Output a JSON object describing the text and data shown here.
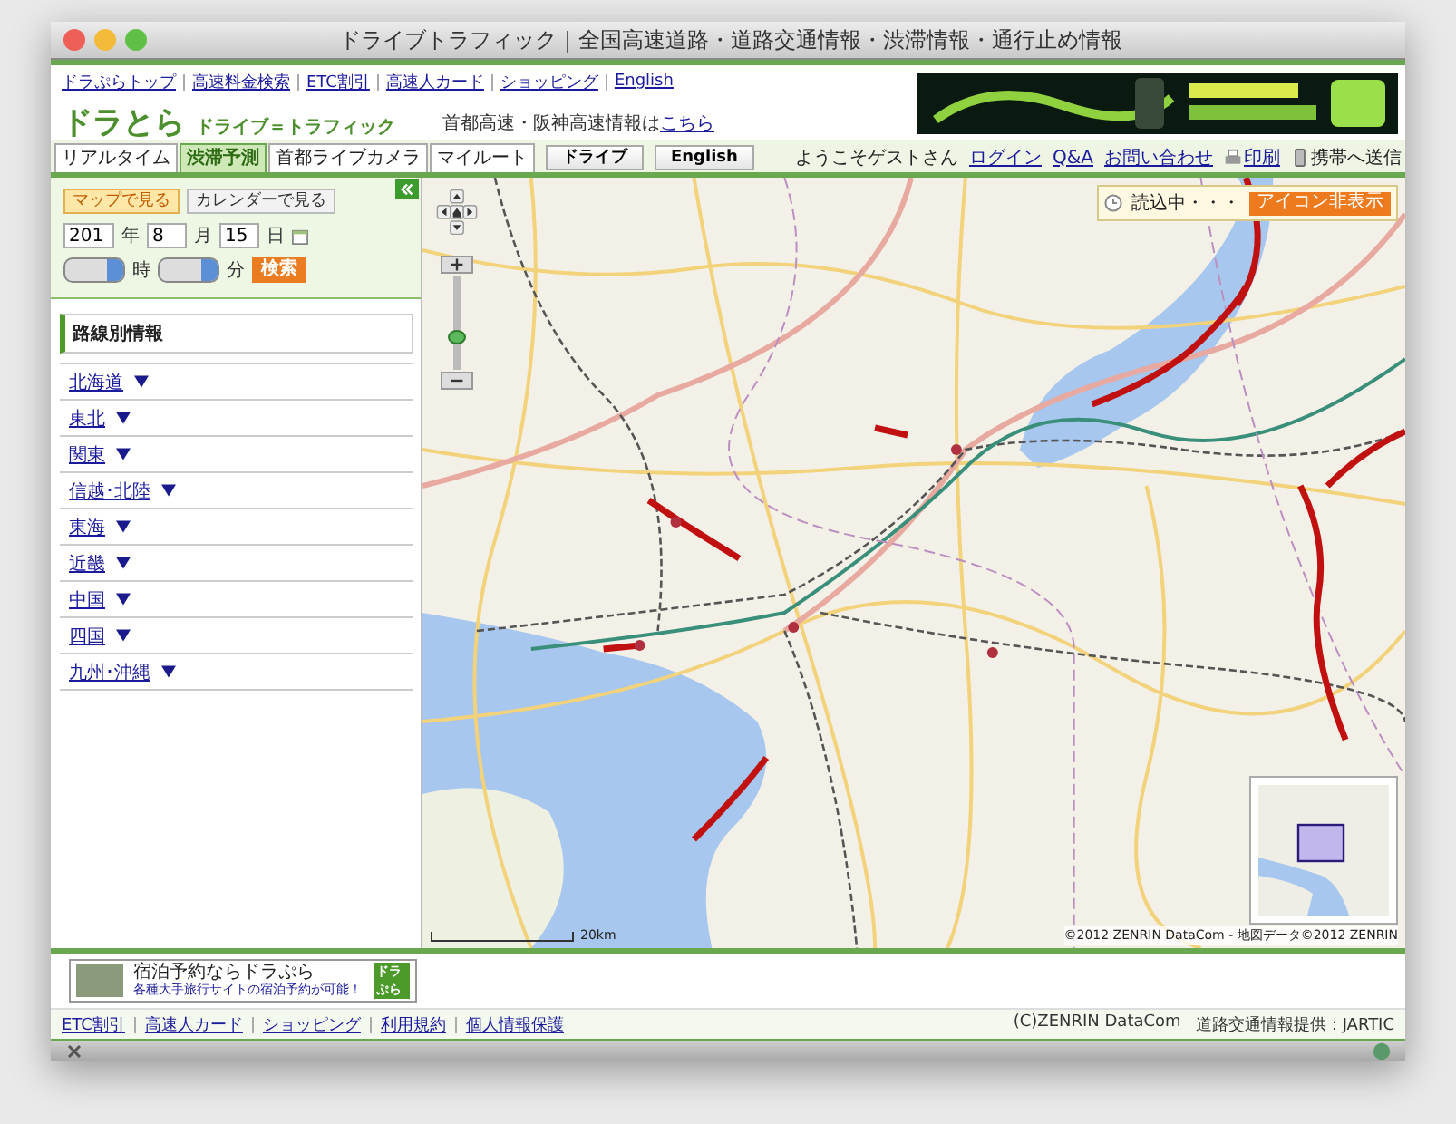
{
  "window": {
    "title": "ドライブトラフィック｜全国高速道路・道路交通情報・渋滞情報・通行止め情報"
  },
  "top_links": [
    "ドラぷらトップ",
    "高速料金検索",
    "ETC割引",
    "高速人カード",
    "ショッピング",
    "English"
  ],
  "logo": {
    "main": "ドラとら",
    "sub": "ドライブ＝トラフィック"
  },
  "notice": {
    "text": "首都高速・阪神高速情報は",
    "link": "こちら"
  },
  "tabs": [
    {
      "label": "リアルタイム",
      "selected": false
    },
    {
      "label": "渋滞予測",
      "selected": true
    },
    {
      "label": "首都ライブカメラ",
      "selected": false
    },
    {
      "label": "マイルート",
      "selected": false
    }
  ],
  "mode_buttons": [
    "ドライブ",
    "English"
  ],
  "user_bar": {
    "greeting": "ようこそゲストさん",
    "links": [
      "ログイン",
      "Q&A",
      "お問い合わせ"
    ],
    "print": "印刷",
    "mobile": "携帯へ送信"
  },
  "panel": {
    "view_buttons": [
      {
        "label": "マップで見る",
        "selected": true
      },
      {
        "label": "カレンダーで見る",
        "selected": false
      }
    ],
    "date": {
      "year": "201",
      "year_unit": "年",
      "month": "8",
      "month_unit": "月",
      "day": "15",
      "day_unit": "日"
    },
    "time": {
      "hour_unit": "時",
      "minute_unit": "分",
      "search": "検索"
    },
    "route_info": {
      "title": "路線別情報",
      "regions": [
        "北海道",
        "東北",
        "関東",
        "信越･北陸",
        "東海",
        "近畿",
        "中国",
        "四国",
        "九州･沖縄"
      ]
    }
  },
  "map": {
    "status": "読込中・・・",
    "hide_icons": "アイコン非表示",
    "scale": "20km",
    "copyright": "©2012 ZENRIN DataCom - 地図データ©2012 ZENRIN",
    "zoom": {
      "level": 0.35
    }
  },
  "ad": {
    "title": "宿泊予約ならドラぷら",
    "tagline": "各種大手旅行サイトの宿泊予約が可能！",
    "brand": "ドラぷら"
  },
  "footer": {
    "links": [
      "ETC割引",
      "高速人カード",
      "ショッピング",
      "利用規約",
      "個人情報保護"
    ],
    "credits": [
      "(C)ZENRIN DataCom",
      "道路交通情報提供：JARTIC"
    ]
  }
}
